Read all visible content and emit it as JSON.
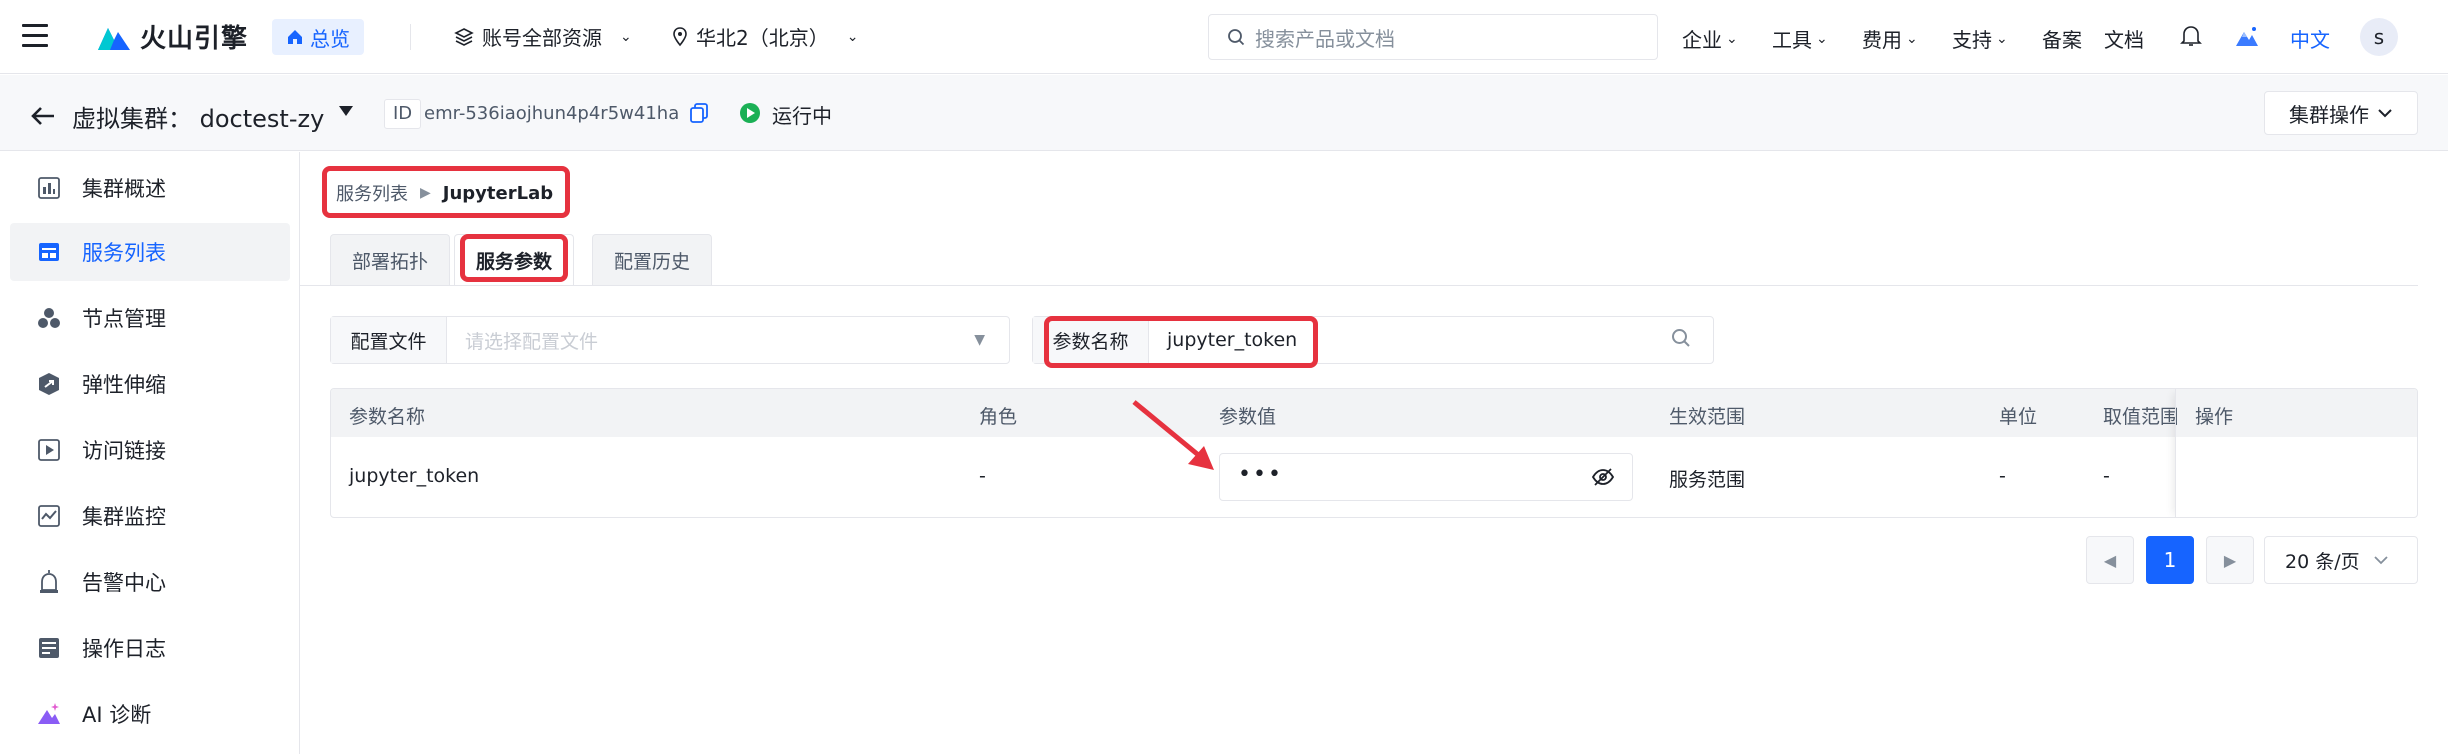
{
  "topbar": {
    "logo_text": "火山引擎",
    "overview_label": "总览",
    "resource_scope": "账号全部资源",
    "region": "华北2（北京）",
    "search_placeholder": "搜索产品或文档",
    "nav": [
      "企业",
      "工具",
      "费用",
      "支持",
      "备案",
      "文档"
    ],
    "language": "中文",
    "avatar_initial": "s"
  },
  "cluster": {
    "title": "虚拟集群：  doctest-zy",
    "id_label": "ID",
    "id_value": "emr-536iaojhun4p4r5w41ha",
    "status": "运行中",
    "operations_label": "集群操作"
  },
  "sidebar": {
    "items": [
      {
        "label": "集群概述",
        "icon": "bar-chart-icon"
      },
      {
        "label": "服务列表",
        "icon": "table-icon"
      },
      {
        "label": "节点管理",
        "icon": "nodes-icon"
      },
      {
        "label": "弹性伸缩",
        "icon": "scale-icon"
      },
      {
        "label": "访问链接",
        "icon": "link-icon"
      },
      {
        "label": "集群监控",
        "icon": "monitor-icon"
      },
      {
        "label": "告警中心",
        "icon": "alarm-icon"
      },
      {
        "label": "操作日志",
        "icon": "log-icon"
      },
      {
        "label": "AI 诊断",
        "icon": "ai-icon"
      }
    ],
    "active_index": 1
  },
  "breadcrumb": {
    "parent": "服务列表",
    "current": "JupyterLab"
  },
  "tabs": [
    "部署拓扑",
    "服务参数",
    "配置历史"
  ],
  "filters": {
    "config_label": "配置文件",
    "config_placeholder": "请选择配置文件",
    "param_label": "参数名称",
    "param_value": "jupyter_token"
  },
  "table": {
    "headers": [
      "参数名称",
      "角色",
      "参数值",
      "生效范围",
      "单位",
      "取值范围",
      "操作"
    ],
    "rows": [
      {
        "name": "jupyter_token",
        "role": "-",
        "value": "•••",
        "scope": "服务范围",
        "unit": "-",
        "range": "-",
        "op": ""
      }
    ]
  },
  "pagination": {
    "current_page": "1",
    "page_size": "20 条/页"
  },
  "colors": {
    "brand": "#1664ff",
    "highlight": "#e6323f",
    "status_running": "#1bb055"
  }
}
